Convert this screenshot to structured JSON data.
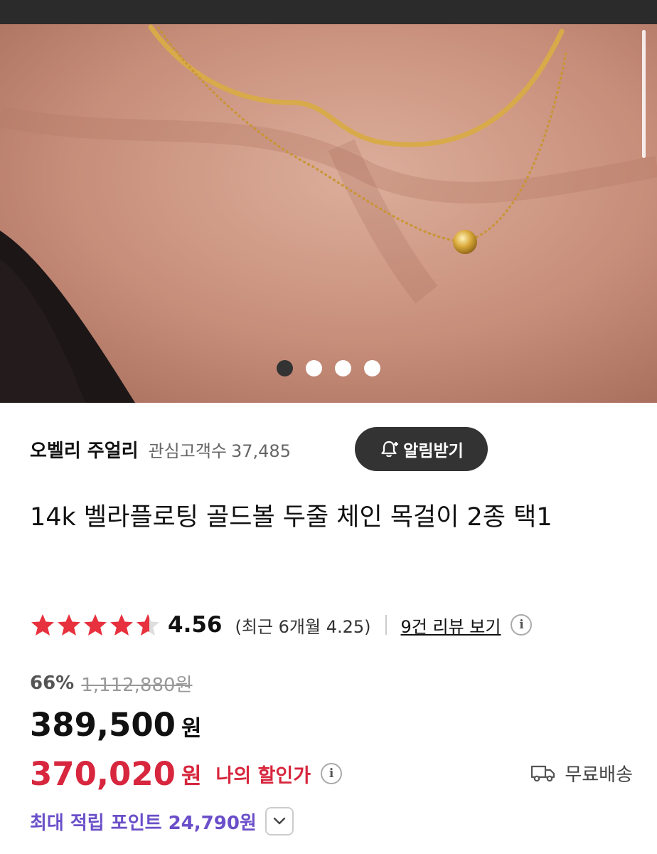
{
  "gallery": {
    "total_slides": 4,
    "active_slide": 1
  },
  "store": {
    "name": "오벨리 주얼리",
    "followers_label": "관심고객수",
    "followers_count": "37,485",
    "alarm_button": "알림받기"
  },
  "product": {
    "title": "14k 벨라플로팅 골드볼 두줄 체인 목걸이 2종 택1"
  },
  "rating": {
    "score": "4.56",
    "stars_value": 4.56,
    "recent": "(최근 6개월 4.25)",
    "review_link": "9건 리뷰 보기"
  },
  "pricing": {
    "discount_rate": "66%",
    "original_price": "1,112,880원",
    "price": "389,500",
    "currency": "원",
    "my_price": "370,020",
    "my_price_label": "나의 할인가",
    "shipping": "무료배송"
  },
  "points": {
    "label": "최대 적립 포인트 24,790원"
  },
  "colors": {
    "accent_red": "#d7263d",
    "points_purple": "#6b4fc9",
    "star_red": "#e8313e",
    "dark_button": "#333333"
  },
  "icons": {
    "alarm": "bell-plus-icon",
    "info": "info-icon",
    "shipping": "truck-icon",
    "toggle": "chevron-down-icon"
  }
}
